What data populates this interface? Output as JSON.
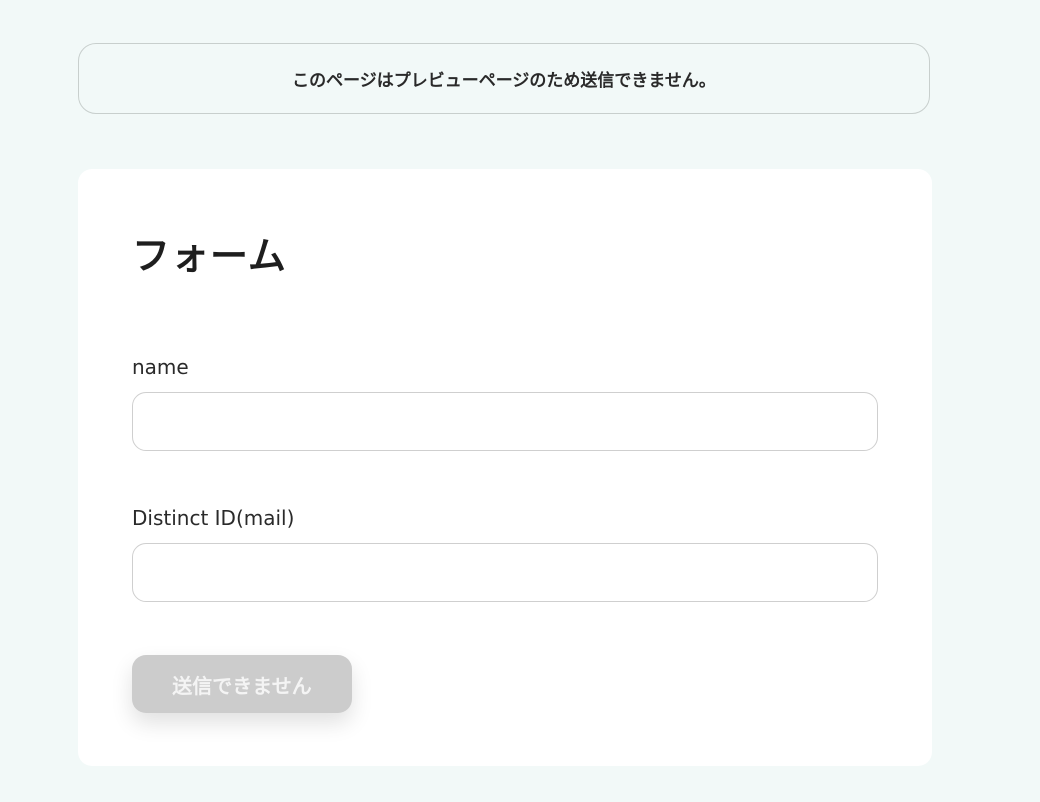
{
  "notice": {
    "text": "このページはプレビューページのため送信できません。"
  },
  "form": {
    "title": "フォーム",
    "fields": [
      {
        "label": "name",
        "value": "",
        "placeholder": ""
      },
      {
        "label": "Distinct ID(mail)",
        "value": "",
        "placeholder": ""
      }
    ],
    "submit_label": "送信できません"
  },
  "colors": {
    "background": "#f2f9f8",
    "card": "#ffffff",
    "button_disabled": "#cccccc"
  }
}
